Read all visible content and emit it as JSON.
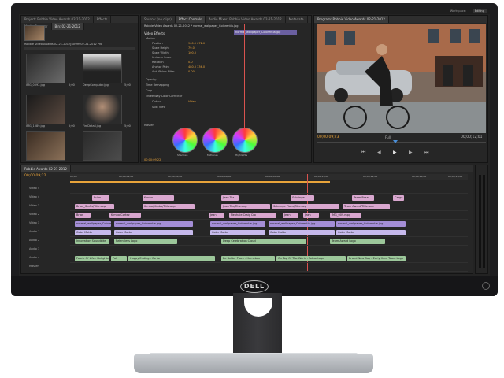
{
  "workspace": {
    "label": "Workspace:",
    "value": "Editing"
  },
  "tabs": [
    "Project: Robbie Video Awards 02-21-2012",
    "Effects",
    "Media Browser",
    "Bin: 02-21-2012",
    "Source: (no clips)",
    "Effect Controls",
    "Audio Mixer: Robbie Video Awards 02-21-2012",
    "Metadata",
    "Program: Robbie Video Awards 02-21-2012"
  ],
  "project": {
    "title": "Robbie Video Awards 02-21-2012[Loremi02-21-2012 Pro",
    "items": [
      {
        "name": "IMG_0092.jpg",
        "dur": "5;00"
      },
      {
        "name": "DeepComputer.jpg",
        "dur": "5;00"
      },
      {
        "name": "IMG_1089.jpg",
        "dur": "5;00"
      },
      {
        "name": "FireDetail.jpg",
        "dur": "5;00"
      }
    ]
  },
  "effect_controls": {
    "header": "Robbie Video Awards 02-21-2012 * normal_wallpaper_Colorentia.jpg",
    "clip": "normal_wallpaper_Colorentia.jpg",
    "section": "Video Effects",
    "rows": [
      {
        "label": "Motion",
        "value": ""
      },
      {
        "label": "Position",
        "value": "960.0   672.0"
      },
      {
        "label": "Scale Height",
        "value": "79.0"
      },
      {
        "label": "Scale Width",
        "value": "100.0"
      },
      {
        "label": "Uniform Scale",
        "value": ""
      },
      {
        "label": "Rotation",
        "value": "0.0"
      },
      {
        "label": "Anchor Point",
        "value": "480.0   336.0"
      },
      {
        "label": "Anti-flicker Filter",
        "value": "0.00"
      },
      {
        "label": "Opacity",
        "value": ""
      },
      {
        "label": "Time Remapping",
        "value": ""
      },
      {
        "label": "Crop",
        "value": ""
      },
      {
        "label": "Three-Way Color Corrector",
        "value": ""
      },
      {
        "label": "Output",
        "value": "Video"
      },
      {
        "label": "Split View",
        "value": ""
      }
    ],
    "master_label": "Master",
    "wheels": [
      "Shadows",
      "Midtones",
      "Highlights"
    ],
    "timecode": "00;00;09;22"
  },
  "program": {
    "timecode": "00;00;09;23",
    "zoom": "Full",
    "duration": "00;00;12;01"
  },
  "timeline": {
    "tab": "Robbie Awards 02-21-2012",
    "timecode": "00;00;09;22",
    "ruler": [
      "00;00",
      "00;00;02;00",
      "00;00;04;00",
      "00;00;06;00",
      "00;00;08;00",
      "00;00;10;00",
      "00;00;12;00",
      "00;00;14;00",
      "00;00;16;00"
    ],
    "tracks": [
      "Video 5",
      "Video 4",
      "Video 3",
      "Video 2",
      "Video 1",
      "Audio 1",
      "Audio 2",
      "Audio 3",
      "Audio 4",
      "Master"
    ],
    "v5": [
      "Brian",
      "Kimbo",
      "Jean Tez",
      "Sabringe",
      "Team Rose",
      "Cargo"
    ],
    "v4": [
      "Brian_Staffs/Title.aep",
      "Kimbo/Kimbo/Title.aep",
      "Jean Tez/Title.aep",
      "Sabringe Plays/Title.aep",
      "Team Award/Title.aep"
    ],
    "v3": [
      "Brian",
      "Kimbo Cortez",
      "Jean",
      "Nephale Craig Cro",
      "Jean",
      "Jean",
      "IMG_009.mpg"
    ],
    "v2": [
      "normal_wallpaper_Colorentia",
      "normal_wallpaper_Colorentia.jpg",
      "normal_wallpaper_Colorentia.jpg",
      "normal_wallpaper_Colorentia.jpg",
      "normal_wallpaper_Colorentia.jpg"
    ],
    "v1": [
      "Color Matte",
      "Color Matte",
      "Color Matte",
      "Color Matte",
      "Color Matte"
    ],
    "a1": [
      "Innovation Soundbite",
      "Relentless Logo",
      "Deep Celebration Cloud",
      "Team Award Logo"
    ],
    "a3": [
      "Fabric Of Life - Delighted",
      "Pal",
      "Happy Ending - Go for",
      "Be Better Place - Homebox",
      "On Top Of The World - Advantage",
      "Brand New Day - Early Hour Team Logo"
    ]
  },
  "brand": "DELL",
  "colors": {
    "accent": "#e8a33a",
    "pink": "#d9a7cf",
    "violet": "#a48ed6",
    "green": "#9cc79a"
  }
}
